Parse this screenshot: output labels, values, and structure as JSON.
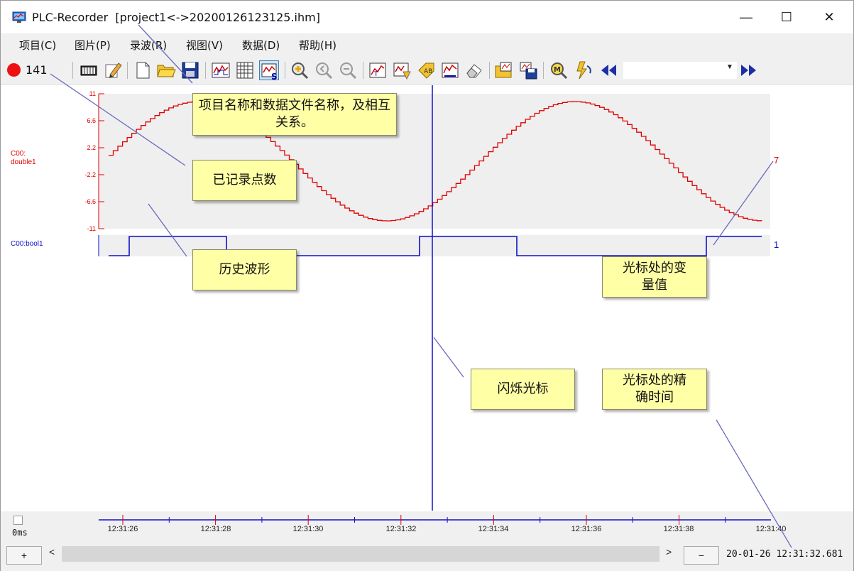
{
  "window": {
    "title": "PLC-Recorder  [project1<->20200126123125.ihm]",
    "minimize": "—",
    "maximize": "☐",
    "close": "✕"
  },
  "menu": [
    "项目(C)",
    "图片(P)",
    "录波(R)",
    "视图(V)",
    "数据(D)",
    "帮助(H)"
  ],
  "toolbar": {
    "record_status_color": "#e11111",
    "record_count": "141",
    "icons": [
      "meter-icon",
      "edit-icon",
      "new-file-icon",
      "open-folder-icon",
      "save-icon",
      "waveform-icon",
      "grid-icon",
      "scale-icon",
      "zoom-in-icon",
      "zoom-out-icon",
      "zoom-reset-icon",
      "trend-icon",
      "analyze-icon",
      "label-icon",
      "measure-icon",
      "eraser-icon",
      "import-icon",
      "export-icon",
      "marker-icon",
      "refresh-icon",
      "rewind-icon",
      "fast-forward-icon"
    ]
  },
  "channels": [
    {
      "label": "C00:\ndouble1",
      "color": "#e00000",
      "y_ticks": [
        "11",
        "6.6",
        "2.2",
        "-2.2",
        "-6.6",
        "-11"
      ],
      "cursor_value": "7"
    },
    {
      "label": "C00:bool1",
      "color": "#1010c8",
      "cursor_value": "1"
    }
  ],
  "time_axis": {
    "ticks": [
      "12:31:26",
      "12:31:28",
      "12:31:30",
      "12:31:32",
      "12:31:34",
      "12:31:36",
      "12:31:38",
      "12:31:40"
    ]
  },
  "bottom": {
    "interval": "0ms",
    "plus": "+",
    "minus": "−",
    "scroll_left": "<",
    "scroll_right": ">",
    "cursor_time": "20-01-26 12:31:32.681"
  },
  "annotations": {
    "project": "项目名称和数据文件名称，及相互关系。",
    "recorded": "已记录点数",
    "history": "历史波形",
    "value": "光标处的变量值",
    "cursor": "闪烁光标",
    "time": "光标处的精确时间"
  },
  "colors": {
    "signal_double": "#e00000",
    "signal_bool": "#1010c8",
    "note_bg": "#ffffa6",
    "cursor_line": "#1010c8"
  }
}
